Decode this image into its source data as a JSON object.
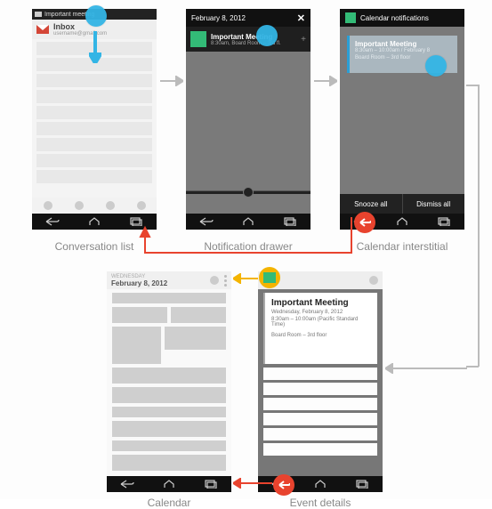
{
  "phone1": {
    "status_label": "Important meeting",
    "inbox_label": "Inbox",
    "account_label": "username@gmail.com",
    "caption": "Conversation list"
  },
  "phone2": {
    "date": "February 8, 2012",
    "close": "✕",
    "notif_title": "Important Meeting",
    "notif_sub": "8:30am, Board Room – 3rd fl.",
    "plus": "+",
    "caption": "Notification drawer"
  },
  "phone3": {
    "header": "Calendar notifications",
    "card_title": "Important Meeting",
    "card_line1": "8:30am – 10:00am  /  February 8",
    "card_line2": "Board Room – 3rd floor",
    "snooze": "Snooze all",
    "dismiss": "Dismiss all",
    "caption": "Calendar interstitial"
  },
  "phone4": {
    "date": "February 8, 2012",
    "date_sub": "WEDNESDAY",
    "caption": "Calendar"
  },
  "phone5": {
    "title": "Important Meeting",
    "line1": "Wednesday, February 8, 2012",
    "line2": "8:30am – 10:00am (Pacific Standard Time)",
    "line3": "Board Room – 3rd floor",
    "caption": "Event details"
  }
}
